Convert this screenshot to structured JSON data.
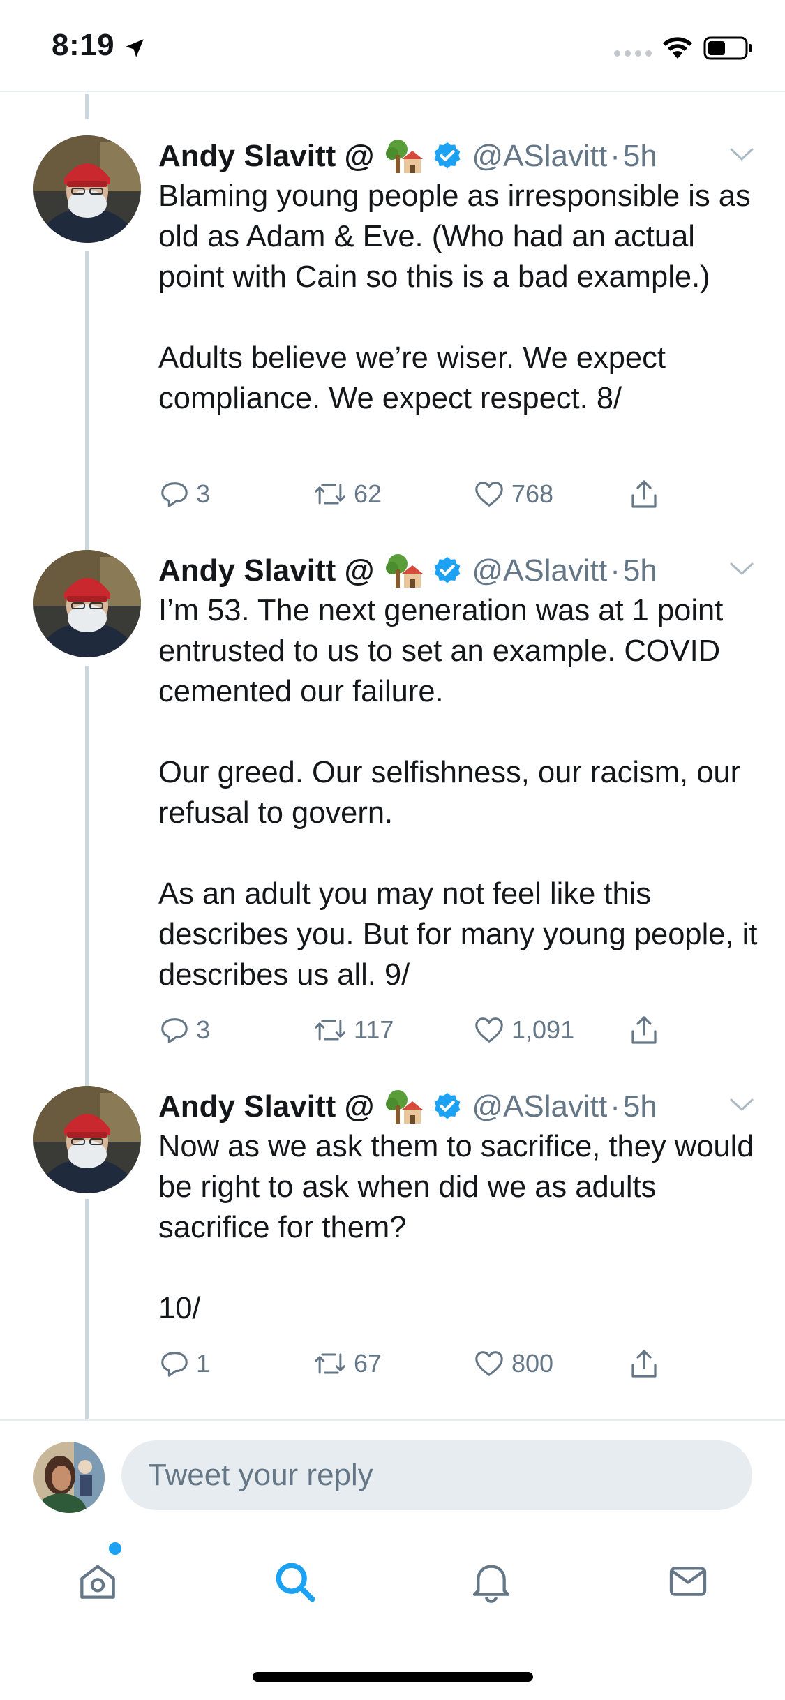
{
  "status_bar": {
    "time": "8:19"
  },
  "tweets": [
    {
      "name": "Andy Slavitt @",
      "handle": "@ASlavitt",
      "separator": "·",
      "time": "5h",
      "text": "Blaming young people as irresponsible is as old as Adam & Eve. (Who had an actual point with Cain so this is a bad example.)\n\nAdults believe we’re wiser. We expect compliance. We expect respect. 8/",
      "replies": "3",
      "retweets": "62",
      "likes": "768"
    },
    {
      "name": "Andy Slavitt @",
      "handle": "@ASlavitt",
      "separator": "·",
      "time": "5h",
      "text": "I’m 53. The next generation was at 1 point entrusted to us to set an example. COVID cemented our failure.\n\nOur greed. Our selfishness, our racism, our refusal to govern.\n\nAs an adult you may not feel like this describes you. But for many young people, it describes us all. 9/",
      "replies": "3",
      "retweets": "117",
      "likes": "1,091"
    },
    {
      "name": "Andy Slavitt @",
      "handle": "@ASlavitt",
      "separator": "·",
      "time": "5h",
      "text": "Now as we ask them to sacrifice, they would be right to ask when did we as adults sacrifice for them?\n\n10/",
      "replies": "1",
      "retweets": "67",
      "likes": "800"
    }
  ],
  "reply_bar": {
    "placeholder": "Tweet your reply"
  },
  "tab_bar": {
    "items": [
      "home-icon",
      "search-icon",
      "bell-icon",
      "mail-icon"
    ],
    "active": "search-icon",
    "home_has_badge": true
  },
  "colors": {
    "accent": "#1da1f2",
    "secondary_text": "#657786",
    "thread_line": "#ccd6dd",
    "input_bg": "#e6ecf0"
  }
}
